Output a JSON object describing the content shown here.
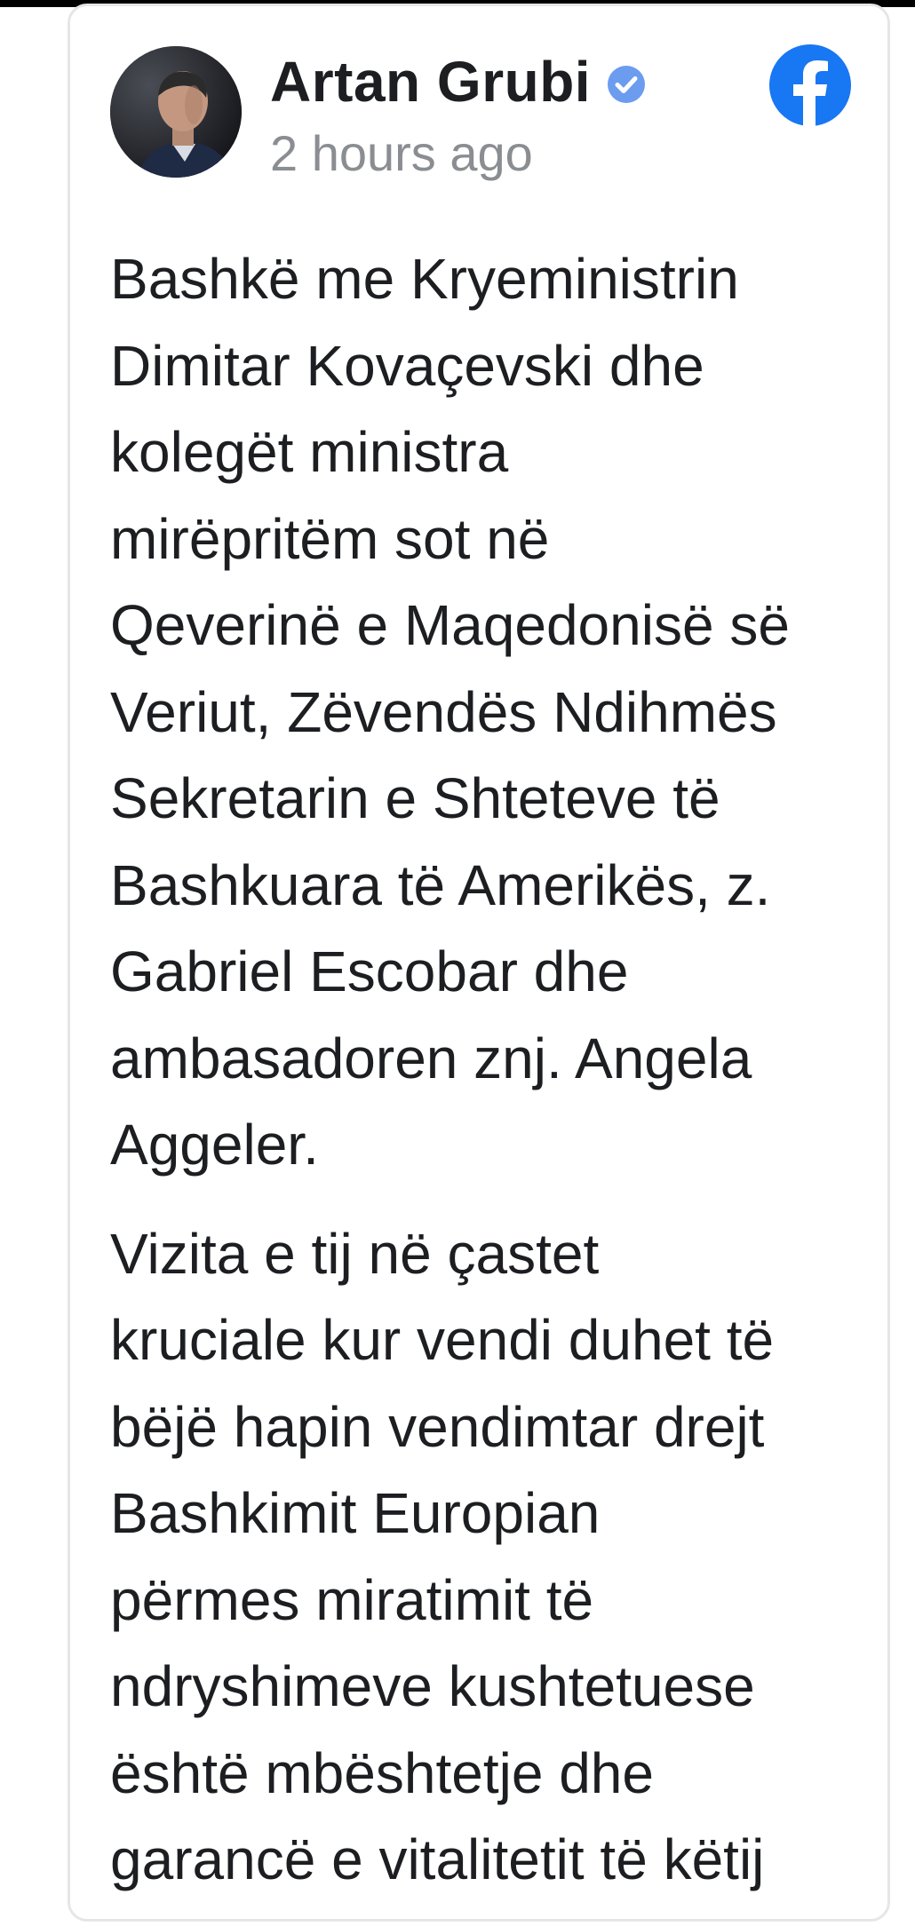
{
  "post": {
    "author": "Artan Grubi",
    "timestamp": "2 hours ago",
    "paragraphs": [
      [
        "Bashkë me Kryeministrin",
        "Dimitar Kovaçevski dhe",
        "kolegët ministra",
        "mirëpritëm sot në",
        "Qeverinë e Maqedonisë së",
        "Veriut, Zëvendës Ndihmës",
        "Sekretarin e Shteteve të",
        "Bashkuara të Amerikës, z.",
        "Gabriel Escobar dhe",
        "ambasadoren znj. Angela",
        "Aggeler."
      ],
      [
        "Vizita e tij në çastet",
        "kruciale kur vendi duhet të",
        "bëjë hapin vendimtar drejt",
        "Bashkimit Europian",
        "përmes miratimit të",
        "ndryshimeve kushtetuese",
        "është mbështetje dhe",
        "garancë e vitalitetit të këtij"
      ]
    ]
  },
  "icons": {
    "verified": "verified-badge-icon",
    "source": "facebook-logo-icon"
  },
  "colors": {
    "facebook_blue": "#1877f2",
    "verified_blue": "#6b9cf0",
    "text": "#1c1e21",
    "muted": "#8a8d91"
  }
}
